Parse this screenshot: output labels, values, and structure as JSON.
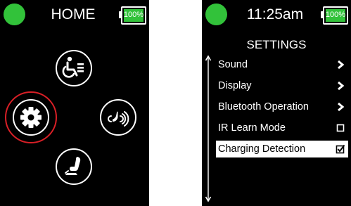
{
  "home_screen": {
    "title": "HOME",
    "battery": "100%",
    "menu": [
      {
        "icon": "wheelchair-seating-icon"
      },
      {
        "icon": "gear-icon",
        "selected": true
      },
      {
        "icon": "bluetooth-wireless-icon"
      },
      {
        "icon": "seat-positioning-icon"
      }
    ]
  },
  "settings_screen": {
    "time": "11:25am",
    "battery": "100%",
    "heading": "SETTINGS",
    "items": [
      {
        "label": "Sound",
        "control": "chevron-right-icon",
        "checked": null
      },
      {
        "label": "Display",
        "control": "chevron-right-icon",
        "checked": null
      },
      {
        "label": "Bluetooth Operation",
        "control": "chevron-right-icon",
        "checked": null
      },
      {
        "label": "IR Learn Mode",
        "control": "checkbox",
        "checked": false
      },
      {
        "label": "Charging Detection",
        "control": "checkbox",
        "checked": true,
        "selected": true
      }
    ]
  },
  "colors": {
    "screen_background": "#000000",
    "status_indicator": "#32c23a",
    "battery_fill": "#32c23a",
    "selection_ring": "#d81f26",
    "selected_row_background": "#ffffff"
  }
}
